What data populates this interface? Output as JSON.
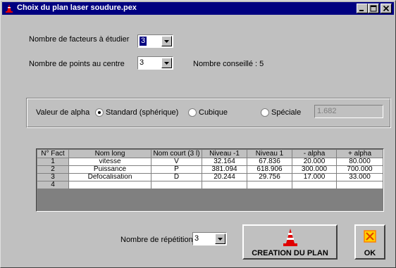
{
  "window": {
    "title": "Choix du plan laser soudure.pex",
    "icon": "cone-icon"
  },
  "factors": {
    "label": "Nombre de facteurs à étudier",
    "value": "3"
  },
  "center_points": {
    "label": "Nombre de points au centre",
    "value": "3",
    "advice": "Nombre conseillé : 5"
  },
  "alpha": {
    "label": "Valeur de alpha",
    "options": [
      {
        "label": "Standard (sphérique)",
        "selected": true
      },
      {
        "label": "Cubique",
        "selected": false
      },
      {
        "label": "Spéciale",
        "selected": false
      }
    ],
    "special_value": "1.682"
  },
  "table": {
    "headers": [
      "N° Fact",
      "Nom long",
      "Nom court (3 l)",
      "Niveau -1",
      "Niveau 1",
      "- alpha",
      "+ alpha"
    ],
    "rows": [
      [
        "1",
        "vitesse",
        "V",
        "32.164",
        "67.836",
        "20.000",
        "80.000"
      ],
      [
        "2",
        "Puissance",
        "P",
        "381.094",
        "618.906",
        "300.000",
        "700.000"
      ],
      [
        "3",
        "Defocalisation",
        "D",
        "20.244",
        "29.756",
        "17.000",
        "33.000"
      ],
      [
        "4",
        "",
        "",
        "",
        "",
        "",
        ""
      ]
    ]
  },
  "repetitions": {
    "label": "Nombre de répétitions",
    "value": "3"
  },
  "buttons": {
    "create_plan": "CREATION DU PLAN",
    "ok": "OK"
  },
  "colors": {
    "titlebar": "#000080",
    "face": "#c0c0c0",
    "cone_red": "#e00000",
    "ok_icon_orange": "#ff8000"
  }
}
